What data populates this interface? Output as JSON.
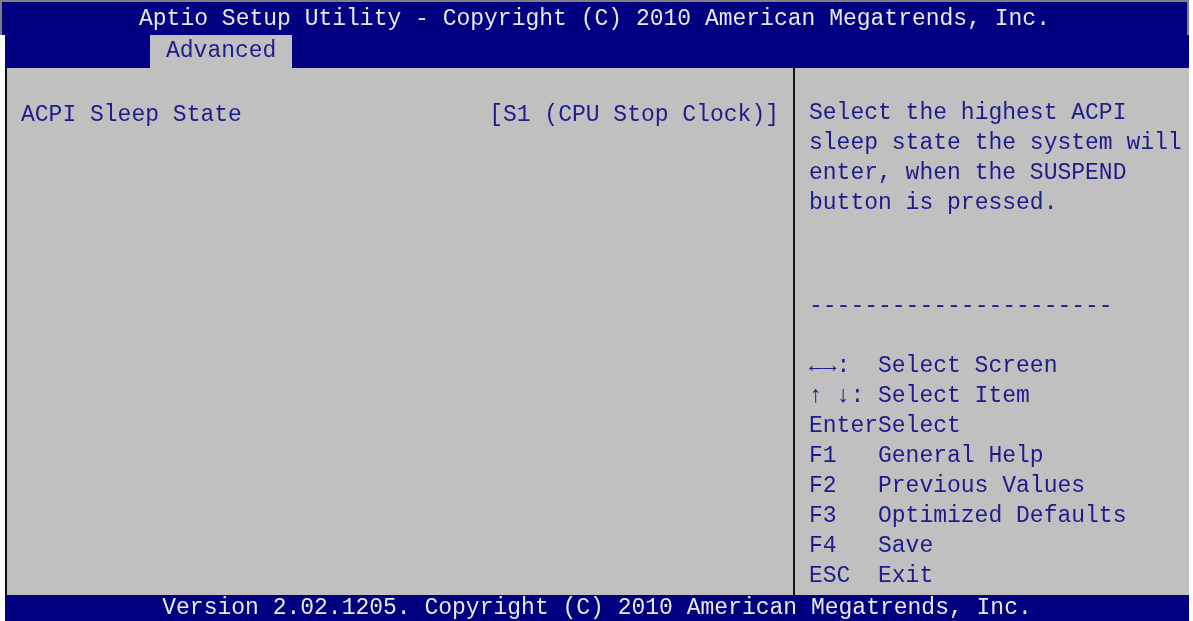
{
  "window": {
    "title": "Aptio Setup Utility - Copyright (C) 2010 American Megatrends, Inc."
  },
  "tabs": [
    {
      "label": "Advanced",
      "selected": true
    }
  ],
  "settings": [
    {
      "label": "ACPI Sleep State",
      "value": "[S1 (CPU Stop Clock)]",
      "selected": true
    }
  ],
  "help": {
    "text": "Select the highest ACPI sleep state the system will enter, when the SUSPEND button is pressed.",
    "separator": "----------------------"
  },
  "keys": [
    {
      "key": "←→:",
      "action": "Select Screen"
    },
    {
      "key": "↑ ↓:",
      "action": "Select Item"
    },
    {
      "key": "Enter",
      "action": "Select"
    },
    {
      "key": "F1",
      "action": "General Help"
    },
    {
      "key": "F2",
      "action": "Previous Values"
    },
    {
      "key": "F3",
      "action": "Optimized Defaults"
    },
    {
      "key": "F4",
      "action": "Save"
    },
    {
      "key": "ESC",
      "action": "Exit"
    }
  ],
  "status_bar": "Version 2.02.1205. Copyright (C) 2010 American Megatrends, Inc."
}
